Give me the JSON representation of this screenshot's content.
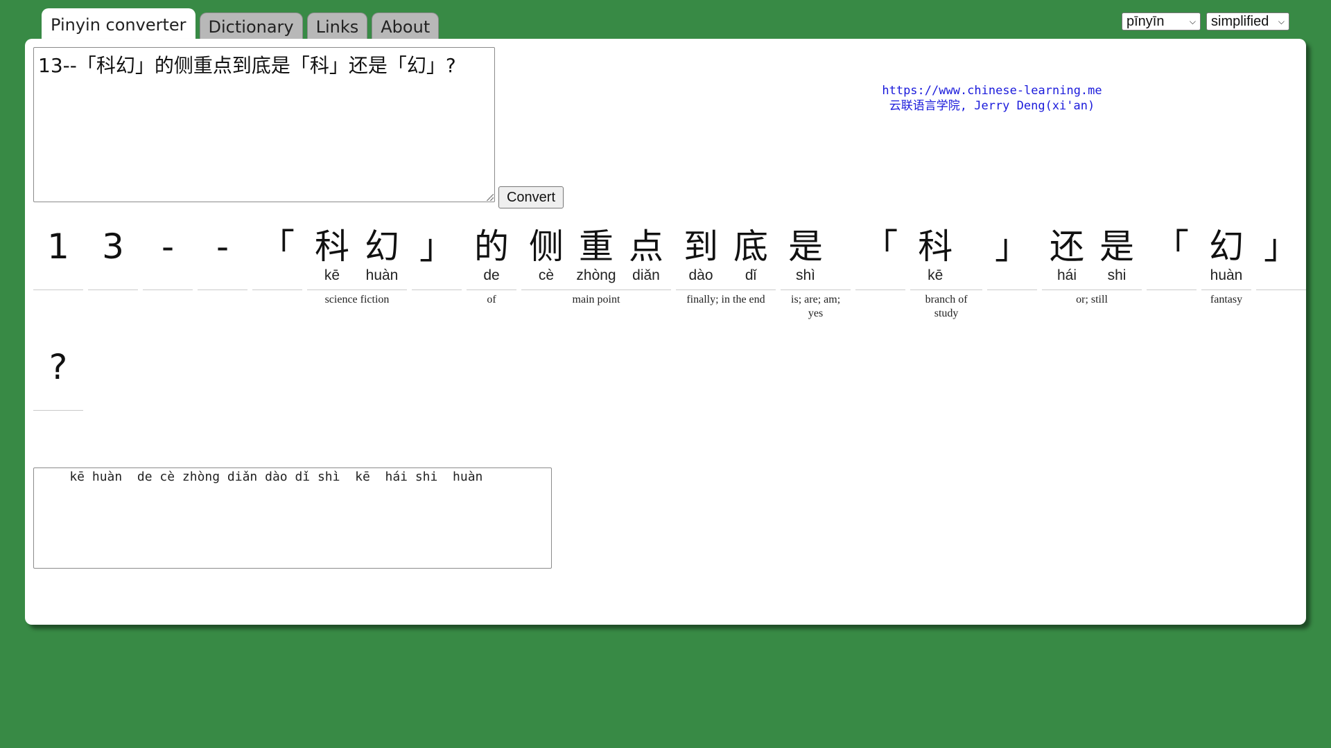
{
  "tabs": [
    {
      "label": "Pinyin converter",
      "active": true
    },
    {
      "label": "Dictionary",
      "active": false
    },
    {
      "label": "Links",
      "active": false
    },
    {
      "label": "About",
      "active": false
    }
  ],
  "selects": {
    "romanization": "pīnyīn",
    "script": "simplified"
  },
  "input": {
    "text": "13--「科幻」的侧重点到底是「科」还是「幻」?"
  },
  "convert_label": "Convert",
  "credit": {
    "url": "https://www.chinese-learning.me",
    "author": "云联语言学院, Jerry Deng(xi'an)"
  },
  "rows": [
    {
      "words": [
        {
          "chars": [
            {
              "ch": "1",
              "py": ""
            }
          ],
          "def": ""
        },
        {
          "chars": [
            {
              "ch": "3",
              "py": ""
            }
          ],
          "def": ""
        },
        {
          "chars": [
            {
              "ch": "-",
              "py": ""
            }
          ],
          "def": ""
        },
        {
          "chars": [
            {
              "ch": "-",
              "py": ""
            }
          ],
          "def": ""
        },
        {
          "chars": [
            {
              "ch": "「",
              "py": ""
            }
          ],
          "def": ""
        },
        {
          "chars": [
            {
              "ch": "科",
              "py": "kē"
            },
            {
              "ch": "幻",
              "py": "huàn"
            }
          ],
          "def": "science fiction"
        },
        {
          "chars": [
            {
              "ch": "」",
              "py": ""
            }
          ],
          "def": ""
        },
        {
          "chars": [
            {
              "ch": "的",
              "py": "de"
            }
          ],
          "def": "of"
        },
        {
          "chars": [
            {
              "ch": "侧",
              "py": "cè"
            },
            {
              "ch": "重",
              "py": "zhòng"
            },
            {
              "ch": "点",
              "py": "diǎn"
            }
          ],
          "def": "main point"
        },
        {
          "chars": [
            {
              "ch": "到",
              "py": "dào"
            },
            {
              "ch": "底",
              "py": "dǐ"
            }
          ],
          "def": "finally; in the end"
        },
        {
          "chars": [
            {
              "ch": "是",
              "py": "shì"
            }
          ],
          "def": "is; are; am; yes"
        },
        {
          "chars": [
            {
              "ch": "「",
              "py": ""
            }
          ],
          "def": ""
        },
        {
          "chars": [
            {
              "ch": "科",
              "py": "kē"
            }
          ],
          "def": "branch of study"
        },
        {
          "chars": [
            {
              "ch": "」",
              "py": ""
            }
          ],
          "def": ""
        },
        {
          "chars": [
            {
              "ch": "还",
              "py": "hái"
            },
            {
              "ch": "是",
              "py": "shi"
            }
          ],
          "def": "or; still"
        },
        {
          "chars": [
            {
              "ch": "「",
              "py": ""
            }
          ],
          "def": ""
        },
        {
          "chars": [
            {
              "ch": "幻",
              "py": "huàn"
            }
          ],
          "def": "fantasy"
        },
        {
          "chars": [
            {
              "ch": "」",
              "py": ""
            }
          ],
          "def": ""
        }
      ]
    },
    {
      "words": [
        {
          "chars": [
            {
              "ch": "?",
              "py": ""
            }
          ],
          "def": ""
        }
      ]
    }
  ],
  "output": {
    "text": "    kē huàn  de cè zhòng diǎn dào dǐ shì  kē  hái shi  huàn"
  }
}
